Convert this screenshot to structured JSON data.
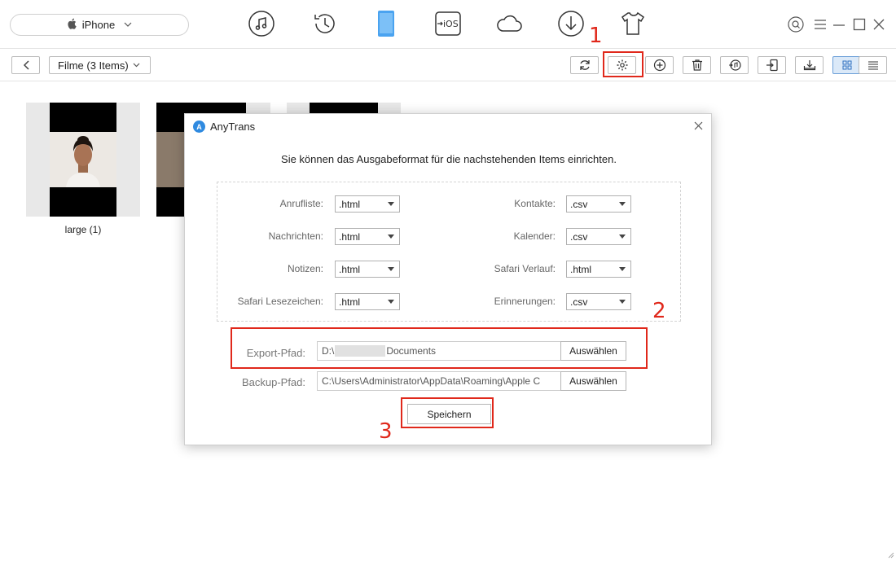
{
  "header": {
    "device_name": "iPhone",
    "nav_icons": [
      "music-icon",
      "history-icon",
      "phone-icon",
      "ios-transfer-icon",
      "cloud-icon",
      "download-icon",
      "shirt-icon"
    ],
    "ios_label": "iOS",
    "accent_color": "#4aa3f0"
  },
  "toolbar": {
    "filter_label": "Filme (3 Items)",
    "buttons": [
      "refresh-icon",
      "settings-icon",
      "add-icon",
      "delete-icon",
      "itunes-icon",
      "to-device-icon",
      "to-computer-icon",
      "grid-view-icon",
      "list-view-icon"
    ]
  },
  "content": {
    "items": [
      {
        "label": "large (1)"
      }
    ]
  },
  "dialog": {
    "title": "AnyTrans",
    "heading": "Sie können das Ausgabeformat für die nachstehenden Items einrichten.",
    "formats": [
      {
        "label": "Anrufliste:",
        "value": ".html"
      },
      {
        "label": "Kontakte:",
        "value": ".csv"
      },
      {
        "label": "Nachrichten:",
        "value": ".html"
      },
      {
        "label": "Kalender:",
        "value": ".csv"
      },
      {
        "label": "Notizen:",
        "value": ".html"
      },
      {
        "label": "Safari Verlauf:",
        "value": ".html"
      },
      {
        "label": "Safari Lesezeichen:",
        "value": ".html"
      },
      {
        "label": "Erinnerungen:",
        "value": ".csv"
      }
    ],
    "export_label": "Export-Pfad:",
    "export_prefix": "D:\\",
    "export_suffix": "Documents",
    "backup_label": "Backup-Pfad:",
    "backup_path": "C:\\Users\\Administrator\\AppData\\Roaming\\Apple C",
    "choose_label": "Auswählen",
    "save_label": "Speichern"
  },
  "annotations": {
    "step1": "1",
    "step2": "2",
    "step3": "3",
    "color": "#e0281b"
  }
}
